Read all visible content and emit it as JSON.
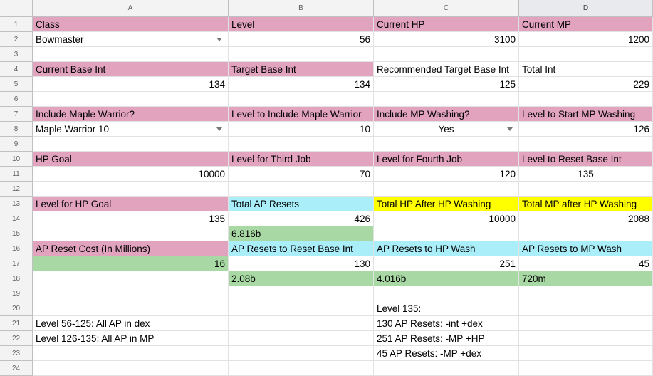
{
  "columns": [
    "A",
    "B",
    "C",
    "D"
  ],
  "rows": [
    "1",
    "2",
    "3",
    "4",
    "5",
    "6",
    "7",
    "8",
    "9",
    "10",
    "11",
    "12",
    "13",
    "14",
    "15",
    "16",
    "17",
    "18",
    "19",
    "20",
    "21",
    "22",
    "23",
    "24"
  ],
  "cells": {
    "A1": "Class",
    "B1": "Level",
    "C1": "Current HP",
    "D1": "Current MP",
    "A2": "Bowmaster",
    "B2": "56",
    "C2": "3100",
    "D2": "1200",
    "A4": "Current Base Int",
    "B4": "Target Base Int",
    "C4": "Recommended Target Base Int",
    "D4": "Total Int",
    "A5": "134",
    "B5": "134",
    "C5": "125",
    "D5": "229",
    "A7": "Include Maple Warrior?",
    "B7": "Level to Include Maple Warrior",
    "C7": "Include MP Washing?",
    "D7": "Level to Start MP Washing",
    "A8": "Maple Warrior 10",
    "B8": "10",
    "C8": "Yes",
    "D8": "126",
    "A10": "HP Goal",
    "B10": "Level for Third Job",
    "C10": "Level for Fourth Job",
    "D10": "Level to Reset Base Int",
    "A11": "10000",
    "B11": "70",
    "C11": "120",
    "D11": "135",
    "A13": "Level for HP Goal",
    "B13": "Total AP Resets",
    "C13": "Total HP After HP Washing",
    "D13": "Total MP after HP Washing",
    "A14": "135",
    "B14": "426",
    "C14": "10000",
    "D14": "2088",
    "B15": "6.816b",
    "A16": "AP Reset Cost (In Millions)",
    "B16": "AP Resets to Reset Base Int",
    "C16": "AP Resets to HP Wash",
    "D16": "AP Resets to MP Wash",
    "A17": "16",
    "B17": "130",
    "C17": "251",
    "D17": "45",
    "B18": "2.08b",
    "C18": "4.016b",
    "D18": "720m",
    "C20": "Level 135:",
    "A21": "Level 56-125: All AP in dex",
    "C21": "130 AP Resets: -int +dex",
    "A22": "Level 126-135: All AP in MP",
    "C22": "251 AP Resets: -MP +HP",
    "C23": "45 AP Resets: -MP +dex"
  },
  "styles": {
    "fills": {
      "pink": "#e1a3be",
      "cyan": "#a9eef9",
      "yellow": "#ffff00",
      "green": "#a8d8a4"
    },
    "A1": "pink",
    "B1": "pink",
    "C1": "pink",
    "D1": "pink",
    "A4": "pink",
    "B4": "pink",
    "D4": "",
    "A7": "pink",
    "B7": "pink",
    "C7": "pink",
    "D7": "pink",
    "A10": "pink",
    "B10": "pink",
    "C10": "pink",
    "D10": "pink",
    "A13": "pink",
    "B13": "cyan",
    "C13": "yellow",
    "D13": "yellow",
    "B15": "green",
    "A16": "pink",
    "B16": "cyan",
    "C16": "cyan",
    "D16": "cyan",
    "A17": "green",
    "B18": "green",
    "C18": "green",
    "D18": "green"
  },
  "align": {
    "B2": "r",
    "C2": "r",
    "D2": "r",
    "A5": "r",
    "B5": "r",
    "C5": "r",
    "D5": "r",
    "B8": "r",
    "C8": "c",
    "D8": "r",
    "A11": "r",
    "B11": "r",
    "C11": "r",
    "D11": "c",
    "A14": "r",
    "B14": "r",
    "C14": "r",
    "D14": "r",
    "A17": "r",
    "B17": "r",
    "C17": "r",
    "D17": "r"
  },
  "dropdowns": [
    "A2",
    "A8",
    "C8"
  ],
  "selected_column": "D"
}
